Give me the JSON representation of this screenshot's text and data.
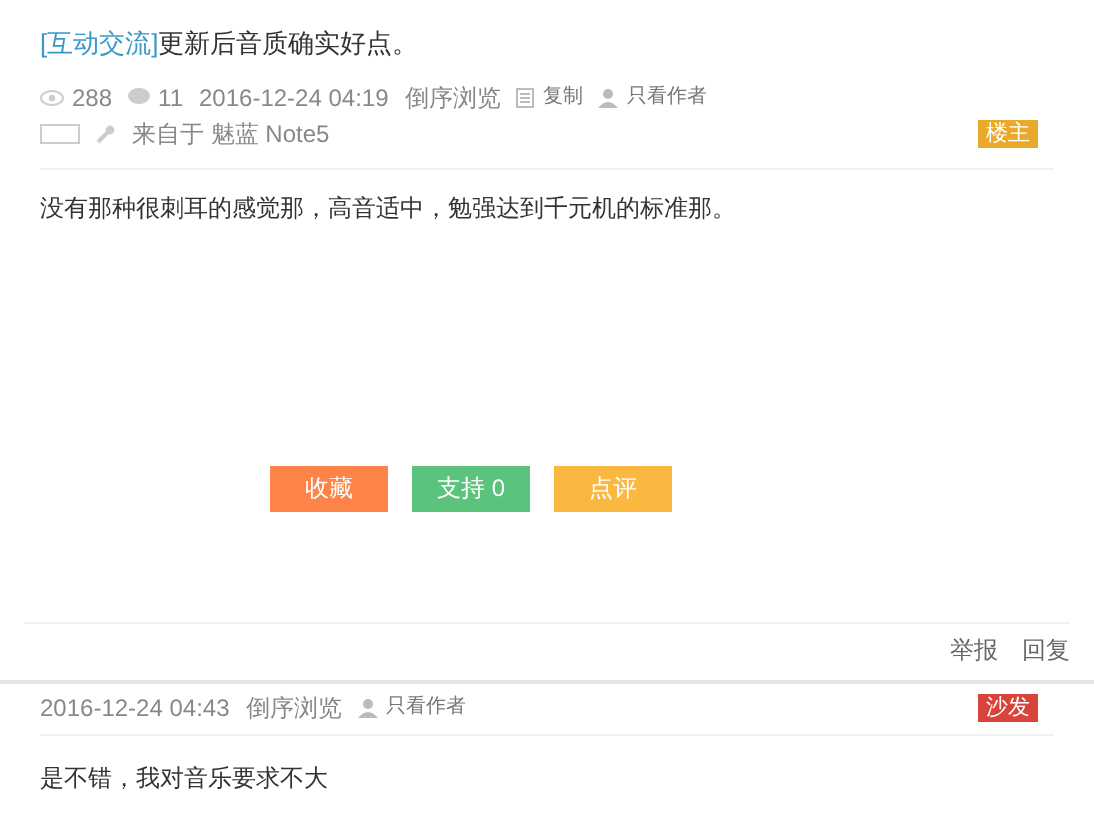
{
  "post": {
    "tag": "[互动交流]",
    "title": "更新后音质确实好点。",
    "views": "288",
    "comments": "11",
    "time": "2016-12-24 04:19",
    "reverse": "倒序浏览",
    "copy": "复制",
    "author_only": "只看作者",
    "source": "来自于 魅蓝 Note5",
    "badge": "楼主",
    "body": "没有那种很刺耳的感觉那，高音适中，勉强达到千元机的标准那。",
    "buttons": [
      {
        "label": "收藏",
        "color": "#fd8349"
      },
      {
        "label": "支持 0",
        "color": "#5bc37c"
      },
      {
        "label": "点评",
        "color": "#fbb840"
      }
    ],
    "actions": [
      "举报",
      "回复"
    ]
  },
  "reply": {
    "time": "2016-12-24 04:43",
    "reverse": "倒序浏览",
    "author_only": "只看作者",
    "badge": "沙发",
    "body": "是不错，我对音乐要求不大"
  }
}
